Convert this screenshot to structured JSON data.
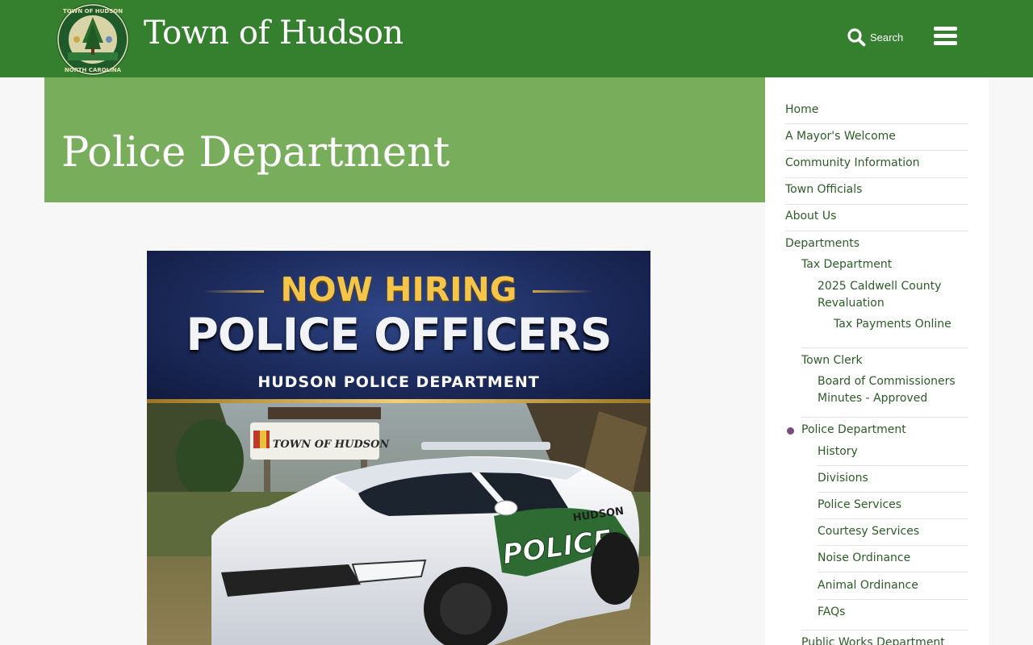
{
  "header": {
    "site_title": "Town of Hudson",
    "search_label": "Search",
    "logo_text_top": "TOWN OF HUDSON",
    "logo_text_bottom": "NORTH CAROLINA",
    "colors": {
      "bar": "#35802e",
      "hero": "#78ad5b",
      "link": "#2b5c26",
      "active_bullet": "#7b4a7f"
    }
  },
  "page": {
    "title": "Police Department"
  },
  "poster": {
    "headline_top": "NOW HIRING",
    "headline_main": "POLICE OFFICERS",
    "department": "HUDSON POLICE DEPARTMENT",
    "sign_text": "TOWN OF HUDSON",
    "car_door_text": "POLICE",
    "car_fender_text": "HUDSON"
  },
  "sidebar": {
    "home": "Home",
    "mayor": "A Mayor's Welcome",
    "community": "Community Information",
    "officials": "Town Officials",
    "about": "About Us",
    "departments": "Departments",
    "tax": "Tax Department",
    "revaluation_1": "2025 Caldwell County",
    "revaluation_2": "Revaluation",
    "tax_payments": "Tax Payments Online",
    "clerk": "Town Clerk",
    "minutes_1": "Board of Commissioners",
    "minutes_2": "Minutes - Approved",
    "police": "Police Department",
    "history": "History",
    "divisions": "Divisions",
    "services": "Police Services",
    "courtesy": "Courtesy Services",
    "noise": "Noise Ordinance",
    "animal": "Animal Ordinance",
    "faqs": "FAQs",
    "public_works": "Public Works Department"
  }
}
